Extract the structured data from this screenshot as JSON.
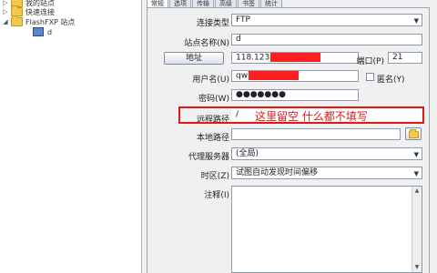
{
  "tree": {
    "items": [
      {
        "label": "我的站点",
        "type": "folder"
      },
      {
        "label": "快速连接",
        "type": "folder"
      },
      {
        "label": "FlashFXP 站点",
        "type": "folder"
      },
      {
        "label": "d",
        "type": "site"
      }
    ]
  },
  "tabs": [
    "常规",
    "选项",
    "传输",
    "高级",
    "书签",
    "统计"
  ],
  "form": {
    "connection_type_label": "连接类型",
    "connection_type_value": "FTP",
    "site_name_label": "站点名称(N)",
    "site_name_value": "d",
    "address_button": "地址",
    "address_value": "118.123",
    "port_label": "端口(P)",
    "port_value": "21",
    "username_label": "用户名(U)",
    "username_value": "qw",
    "anonymous_label": "匿名(Y)",
    "password_label": "密码(W)",
    "password_value": "●●●●●●●",
    "remote_path_label": "远程路径",
    "remote_path_value": "/",
    "local_path_label": "本地路径",
    "local_path_value": "",
    "proxy_label": "代理服务器",
    "proxy_value": "(全局)",
    "timezone_label": "时区(Z)",
    "timezone_value": "试图自动发现时间偏移",
    "notes_label": "注释(I)"
  },
  "annotation": {
    "text": "这里留空 什么都不填写",
    "color": "#e01818"
  },
  "colors": {
    "redaction": "#ff1f1f",
    "border": "#8c9bab"
  },
  "icons": [
    "folder-icon",
    "site-icon",
    "expand-icon",
    "dropdown-arrow-icon"
  ]
}
